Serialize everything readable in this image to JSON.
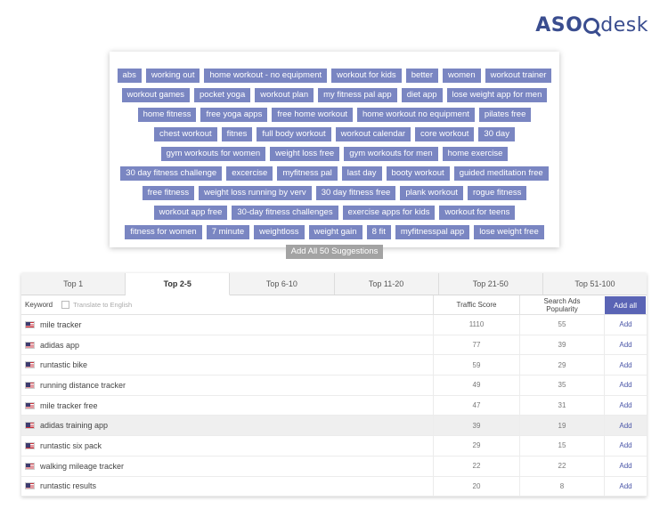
{
  "logo": {
    "part1": "ASO",
    "part2": "desk"
  },
  "suggestions": {
    "tags": [
      "abs",
      "working out",
      "home workout - no equipment",
      "workout for kids",
      "better",
      "women",
      "workout trainer",
      "workout games",
      "pocket yoga",
      "workout plan",
      "my fitness pal app",
      "diet app",
      "lose weight app for men",
      "home fitness",
      "free yoga apps",
      "free home workout",
      "home workout no equipment",
      "pilates free",
      "chest workout",
      "fitnes",
      "full body workout",
      "workout calendar",
      "core workout",
      "30 day",
      "gym workouts for women",
      "weight loss free",
      "gym workouts for men",
      "home exercise",
      "30 day fitness challenge",
      "excercise",
      "myfitness pal",
      "last day",
      "booty workout",
      "guided meditation free",
      "free fitness",
      "weight loss running by verv",
      "30 day fitness free",
      "plank workout",
      "rogue fitness",
      "workout app free",
      "30-day fitness challenges",
      "exercise apps for kids",
      "workout for teens",
      "fitness for women",
      "7 minute",
      "weightloss",
      "weight gain",
      "8 fit",
      "myfitnesspal app",
      "lose weight free"
    ],
    "add_all_label": "Add All 50 Suggestions"
  },
  "table": {
    "tabs": [
      "Top 1",
      "Top 2-5",
      "Top 6-10",
      "Top 11-20",
      "Top 21-50",
      "Top 51-100"
    ],
    "active_tab": "Top 2-5",
    "headers": {
      "keyword": "Keyword",
      "translate": "Translate to English",
      "traffic": "Traffic Score",
      "popularity": "Search Ads Popularity",
      "add_all": "Add all"
    },
    "add_label": "Add",
    "rows": [
      {
        "keyword": "mile tracker",
        "traffic": "1110",
        "popularity": "55"
      },
      {
        "keyword": "adidas app",
        "traffic": "77",
        "popularity": "39"
      },
      {
        "keyword": "runtastic bike",
        "traffic": "59",
        "popularity": "29"
      },
      {
        "keyword": "running distance tracker",
        "traffic": "49",
        "popularity": "35"
      },
      {
        "keyword": "mile tracker free",
        "traffic": "47",
        "popularity": "31"
      },
      {
        "keyword": "adidas training app",
        "traffic": "39",
        "popularity": "19"
      },
      {
        "keyword": "runtastic six pack",
        "traffic": "29",
        "popularity": "15"
      },
      {
        "keyword": "walking mileage tracker",
        "traffic": "22",
        "popularity": "22"
      },
      {
        "keyword": "runtastic results",
        "traffic": "20",
        "popularity": "8"
      }
    ],
    "highlight_row": 5
  },
  "colors": {
    "tag": "#7a86c2",
    "add_all_tag": "#a3a3a3",
    "brand": "#3a4d8f",
    "add_all_button": "#5a64b5"
  }
}
